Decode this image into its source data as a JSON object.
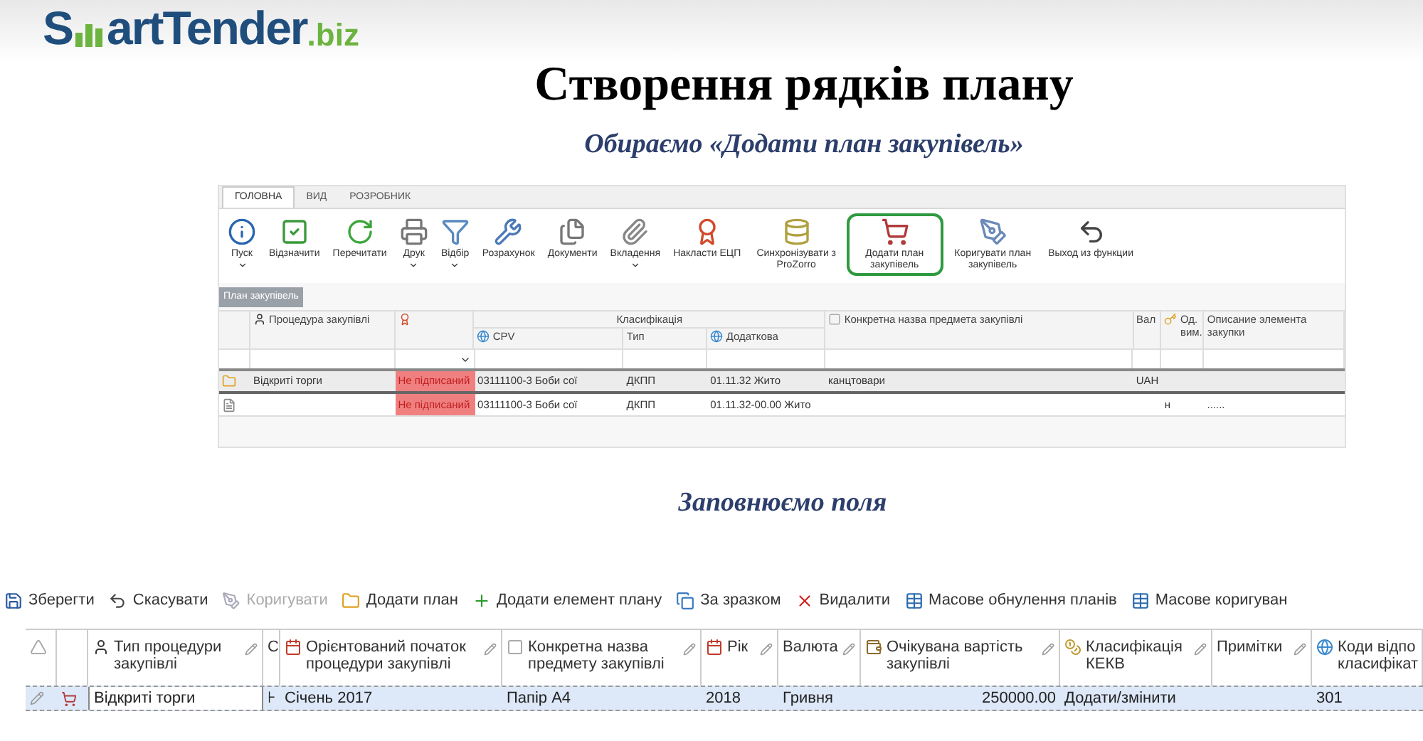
{
  "logo": {
    "first": "S",
    "rest": "artTender",
    "suffix": ".biz"
  },
  "title": "Створення рядків плану",
  "subtitle": "Обираємо «Додати план закупівель»",
  "app1": {
    "tabs": [
      {
        "label": "ГОЛОВНА",
        "selected": true
      },
      {
        "label": "ВИД",
        "selected": false
      },
      {
        "label": "РОЗРОБНИК",
        "selected": false
      }
    ],
    "toolbar": [
      {
        "label": "Пуск",
        "kind": "start",
        "dropdown": true,
        "highlighted": false
      },
      {
        "label": "Відзначити",
        "kind": "check",
        "dropdown": false,
        "highlighted": false
      },
      {
        "label": "Перечитати",
        "kind": "refresh",
        "dropdown": false,
        "highlighted": false
      },
      {
        "label": "Друк",
        "kind": "printer",
        "dropdown": true,
        "highlighted": false
      },
      {
        "label": "Відбір",
        "kind": "filter",
        "dropdown": true,
        "highlighted": false
      },
      {
        "label": "Розрахунок",
        "kind": "wrench",
        "dropdown": false,
        "highlighted": false
      },
      {
        "label": "Документи",
        "kind": "documents",
        "dropdown": false,
        "highlighted": false
      },
      {
        "label": "Вкладення",
        "kind": "paperclip",
        "dropdown": true,
        "highlighted": false
      },
      {
        "label": "Накласти ЕЦП",
        "kind": "seal",
        "dropdown": false,
        "highlighted": false
      },
      {
        "label": "Синхронізувати з ProZorro",
        "kind": "database",
        "dropdown": false,
        "highlighted": false
      },
      {
        "label": "Додати план закупівель",
        "kind": "cart",
        "dropdown": false,
        "highlighted": true
      },
      {
        "label": "Коригувати план закупівель",
        "kind": "pen",
        "dropdown": false,
        "highlighted": false
      },
      {
        "label": "Выход из функции",
        "kind": "undo",
        "dropdown": false,
        "highlighted": false
      }
    ],
    "panel_tab": "План закупівель",
    "group_header": "Класифікація",
    "columns": [
      {
        "kind": "none",
        "grouped": false
      },
      {
        "label": "Процедура закупівлі",
        "kind": "person",
        "grouped": false
      },
      {
        "kind": "seal",
        "grouped": false
      },
      {
        "label": "CPV",
        "kind": "globe",
        "grouped": true
      },
      {
        "label": "Тип",
        "kind": "none",
        "grouped": true
      },
      {
        "label": "Додаткова",
        "kind": "globe",
        "grouped": true
      },
      {
        "label": "Конкретна назва предмета закупівлі",
        "kind": "box",
        "grouped": false
      },
      {
        "label": "Вал",
        "kind": "none",
        "grouped": false
      },
      {
        "label": "Од. вим.",
        "kind": "key",
        "grouped": false
      },
      {
        "label": "Описание элемента закупки",
        "kind": "none",
        "grouped": false
      }
    ],
    "rows": [
      {
        "selected": true,
        "kind": "folder",
        "cells": [
          null,
          "Відкриті торги",
          "Не підписаний",
          "03111100-3 Боби сої",
          "ДКПП",
          "01.11.32 Жито",
          "канцтовари",
          "UAH",
          null,
          null
        ]
      },
      {
        "selected": false,
        "kind": "document",
        "cells": [
          null,
          null,
          "Не підписаний",
          "03111100-3 Боби сої",
          "ДКПП",
          "01.11.32-00.00 Жито",
          null,
          null,
          "н",
          "......"
        ]
      }
    ]
  },
  "section2_title": "Заповнюємо поля",
  "app2": {
    "toolbar": [
      {
        "label": "Зберегти",
        "kind": "save",
        "disabled": false
      },
      {
        "label": "Скасувати",
        "kind": "undo",
        "disabled": false
      },
      {
        "label": "Коригувати",
        "kind": "pen",
        "disabled": true
      },
      {
        "label": "Додати план",
        "kind": "folder",
        "disabled": false
      },
      {
        "label": "Додати елемент плану",
        "kind": "plus",
        "disabled": false
      },
      {
        "label": "За зразком",
        "kind": "copy",
        "disabled": false
      },
      {
        "label": "Видалити",
        "kind": "delete",
        "disabled": false
      },
      {
        "label": "Масове обнулення планів",
        "kind": "table",
        "disabled": false
      },
      {
        "label": "Масове коригуван",
        "kind": "table",
        "disabled": false
      }
    ],
    "columns": [
      {
        "kind": "corner",
        "editable": false
      },
      {
        "kind": "none",
        "editable": false
      },
      {
        "label": "Тип процедури закупівлі",
        "kind": "person",
        "editable": true
      },
      {
        "label": "С",
        "kind": "none"
      },
      {
        "label": "Орієнтований початок процедури закупівлі",
        "kind": "calendar",
        "editable": true
      },
      {
        "label": "Конкретна назва предмету закупівлі",
        "kind": "box",
        "editable": true
      },
      {
        "label": "Рік",
        "kind": "calendar",
        "editable": true
      },
      {
        "label": "Валюта",
        "kind": "none",
        "editable": true
      },
      {
        "label": "Очікувана вартість закупівлі",
        "kind": "money",
        "editable": true
      },
      {
        "label": "Класифікація КЕКВ",
        "kind": "coins",
        "editable": true
      },
      {
        "label": "Примітки",
        "kind": "none",
        "editable": true
      },
      {
        "label": "Коди відпо класифікат",
        "kind": "globe"
      }
    ],
    "rows": [
      {
        "selected": true,
        "cells": [
          null,
          null,
          "Відкриті торги",
          "⊦",
          "Січень 2017",
          "Папір А4",
          "2018",
          "Гривня",
          "250000.00",
          "Додати/змінити",
          null,
          "301"
        ]
      }
    ]
  }
}
